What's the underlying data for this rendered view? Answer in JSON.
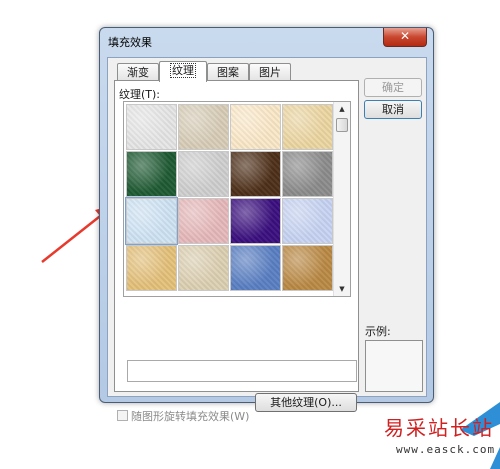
{
  "dialog": {
    "title": "填充效果",
    "close_label": "✕",
    "tabs": [
      {
        "label": "渐变",
        "active": false
      },
      {
        "label": "纹理",
        "active": true
      },
      {
        "label": "图案",
        "active": false
      },
      {
        "label": "图片",
        "active": false
      }
    ],
    "texture_label": "纹理(T):",
    "textures": [
      {
        "name": "white-marble",
        "color": "#e6e6e6"
      },
      {
        "name": "fabric-beige",
        "color": "#d8cdb8"
      },
      {
        "name": "parchment",
        "color": "#fbe8c8"
      },
      {
        "name": "papyrus",
        "color": "#ecd6a2"
      },
      {
        "name": "green-marble",
        "color": "#1f5a33"
      },
      {
        "name": "white-gray-marble",
        "color": "#cfcfcf"
      },
      {
        "name": "brown-marble",
        "color": "#4e2f18"
      },
      {
        "name": "granite",
        "color": "#8c8c8c"
      },
      {
        "name": "blue-tissue-paper",
        "color": "#cfe3f4"
      },
      {
        "name": "pink-tissue-paper",
        "color": "#e7b9bb"
      },
      {
        "name": "purple-mesh",
        "color": "#3a0f7e"
      },
      {
        "name": "bouquet",
        "color": "#c7d3f2"
      },
      {
        "name": "cork",
        "color": "#e4c07a"
      },
      {
        "name": "canvas",
        "color": "#ddd0b3"
      },
      {
        "name": "denim",
        "color": "#5a7fc3"
      },
      {
        "name": "woven-mat",
        "color": "#bb8a46"
      }
    ],
    "texture_name_value": "",
    "other_texture_label": "其他纹理(O)...",
    "ok_label": "确定",
    "cancel_label": "取消",
    "preview_label": "示例:",
    "rotate_checkbox_label": "随图形旋转填充效果(W)",
    "rotate_checked": false
  },
  "watermark": {
    "title": "易采站长站",
    "url": "www.easck.com"
  }
}
